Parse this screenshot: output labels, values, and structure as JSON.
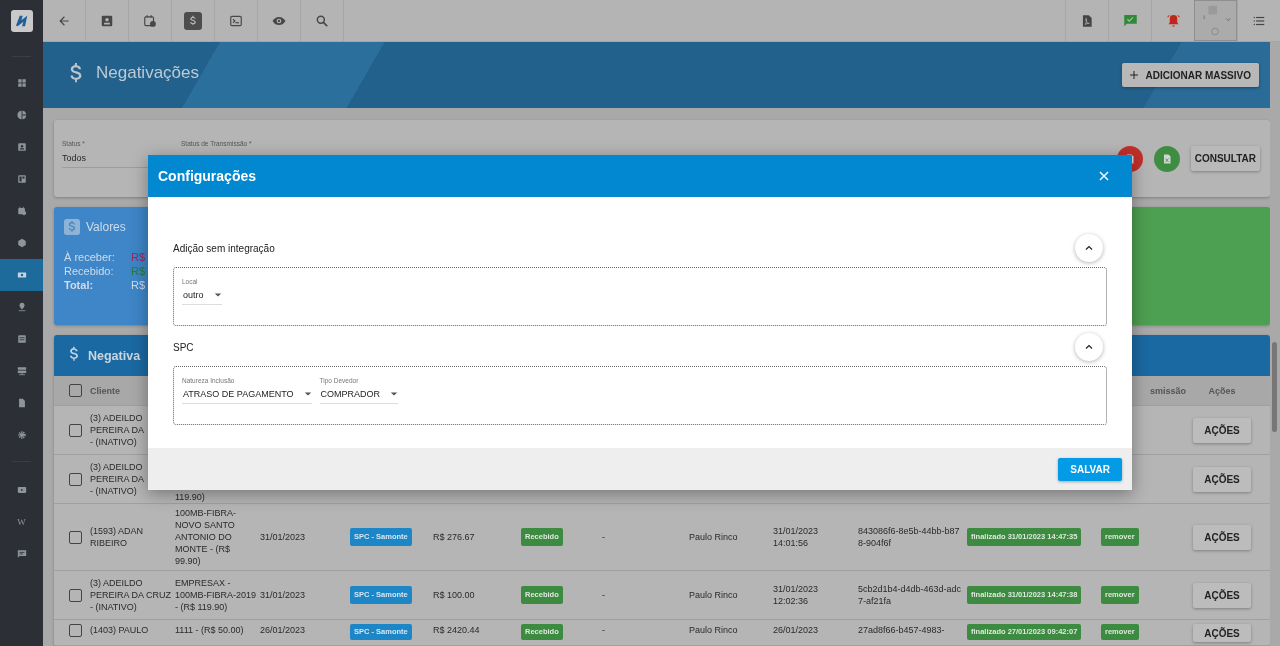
{
  "sidebar": {
    "items": [
      {
        "selected": false
      },
      {
        "selected": false
      },
      {
        "selected": false
      },
      {
        "selected": false
      },
      {
        "selected": false
      },
      {
        "selected": false
      },
      {
        "selected": true
      },
      {
        "selected": false
      },
      {
        "selected": false
      },
      {
        "selected": false
      },
      {
        "selected": false
      },
      {
        "selected": false
      },
      {
        "selected": false
      },
      {
        "selected": false,
        "glyph": "W"
      },
      {
        "selected": false
      }
    ]
  },
  "toolbar": {
    "items": [
      {
        "selected": false
      },
      {
        "selected": false
      },
      {
        "selected": false
      },
      {
        "selected": true
      },
      {
        "selected": false
      },
      {
        "selected": false
      },
      {
        "selected": false
      }
    ]
  },
  "header": {
    "title": "Negativações",
    "button": "ADICIONAR MASSIVO"
  },
  "filters": {
    "fields": [
      {
        "label": "Status *",
        "value": "Todos"
      },
      {
        "label": "Status de Transmissão *"
      }
    ],
    "button": "CONSULTAR"
  },
  "values_card": {
    "title": "Valores",
    "rows": [
      {
        "kind": "normal",
        "label": "À receber:",
        "value": "R$",
        "color": "#a3245a"
      },
      {
        "kind": "normal",
        "label": "Recebido:",
        "value": "R$",
        "color": "#2a7a2e"
      },
      {
        "kind": "total",
        "label": "Total:",
        "value": "R$",
        "color": "#d0dcea"
      }
    ]
  },
  "table": {
    "title": "Negativa",
    "header_checked": false,
    "columns": [
      "Cliente",
      "smissão",
      "Ações"
    ],
    "rows": [
      {
        "checked": false,
        "client_lines": [
          "(3) ADEILDO",
          "PEREIRA DA",
          "- (INATIVO)"
        ],
        "button": "AÇÕES"
      },
      {
        "checked": false,
        "client_lines": [
          "(3) ADEILDO",
          "PEREIRA DA",
          "- (INATIVO)"
        ],
        "plan": "119.90)",
        "plan_tail": true,
        "button": "AÇÕES"
      },
      {
        "checked": false,
        "client": "(1593) ADAN RIBEIRO",
        "plan": "100MB-FIBRA-NOVO SANTO ANTONIO DO MONTE - (R$ 99.90)",
        "date": "31/01/2023",
        "type": "SPC - Samonte",
        "value": "R$ 276.67",
        "status": "Recebido",
        "note": "-",
        "user": "Paulo Rinco",
        "sent": "31/01/2023 14:01:56",
        "id": "843086f6-8e5b-44bb-b878-904f6f",
        "transmission": "finalizado 31/01/2023 14:47:35",
        "action": "remover",
        "button": "AÇÕES"
      },
      {
        "checked": false,
        "client": "(3) ADEILDO PEREIRA DA CRUZ - (INATIVO)",
        "plan": "EMPRESAX - 100MB-FIBRA-2019 - (R$ 119.90)",
        "date": "31/01/2023",
        "type": "SPC - Samonte",
        "value": "R$ 100.00",
        "status": "Recebido",
        "note": "-",
        "user": "Paulo Rinco",
        "sent": "31/01/2023 12:02:36",
        "id": "5cb2d1b4-d4db-463d-adc7-af21fa",
        "transmission": "finalizado 31/01/2023 14:47:38",
        "action": "remover",
        "button": "AÇÕES"
      },
      {
        "checked": false,
        "client": "(1403) PAULO",
        "plan": "1111 - (R$ 50.00)",
        "date": "26/01/2023",
        "type": "SPC - Samonte",
        "value": "R$ 2420.44",
        "status": "Recebido",
        "note": "-",
        "user": "Paulo Rinco",
        "sent": "26/01/2023",
        "id": "27ad8f66-b457-4983-",
        "transmission": "finalizado 27/01/2023 09:42:07",
        "action": "remover",
        "button": "AÇÕES"
      }
    ]
  },
  "modal": {
    "title": "Configurações",
    "sections": [
      {
        "title": "Adição sem integração",
        "expanded": true,
        "fields": [
          {
            "label": "Local",
            "value": "outro"
          }
        ]
      },
      {
        "title": "SPC",
        "expanded": true,
        "fields": [
          {
            "label": "Natureza Inclusão",
            "value": "ATRASO DE PAGAMENTO"
          },
          {
            "label": "Tipo Devedor",
            "value": "COMPRADOR"
          }
        ]
      }
    ],
    "button": "SALVAR"
  }
}
